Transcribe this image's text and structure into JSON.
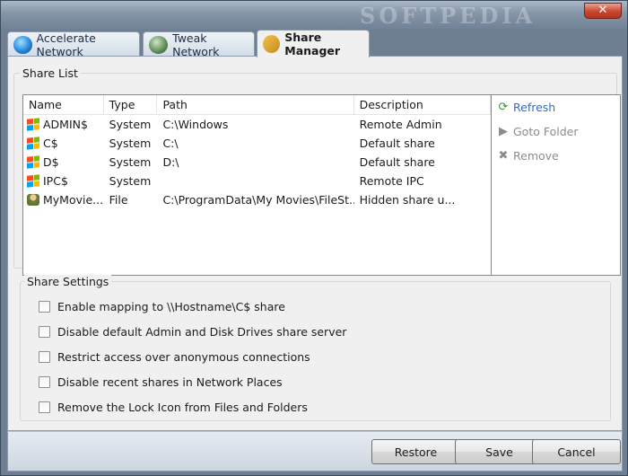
{
  "window": {
    "watermark": "SOFTPEDIA",
    "close_glyph": "✕"
  },
  "tabs": [
    {
      "label": "Accelerate Network",
      "icon": "network-globe-icon"
    },
    {
      "label": "Tweak Network",
      "icon": "tweak-network-icon"
    },
    {
      "label": "Share Manager",
      "icon": "share-manager-icon",
      "active": true
    }
  ],
  "share_list": {
    "title": "Share List",
    "columns": {
      "name": "Name",
      "type": "Type",
      "path": "Path",
      "description": "Description"
    },
    "rows": [
      {
        "name": "ADMIN$",
        "type": "System",
        "path": "C:\\Windows",
        "description": "Remote Admin"
      },
      {
        "name": "C$",
        "type": "System",
        "path": "C:\\",
        "description": "Default share"
      },
      {
        "name": "D$",
        "type": "System",
        "path": "D:\\",
        "description": "Default share"
      },
      {
        "name": "IPC$",
        "type": "System",
        "path": "",
        "description": "Remote IPC"
      },
      {
        "name": "MyMovie...",
        "type": "File",
        "path": "C:\\ProgramData\\My Movies\\FileSt...",
        "description": "Hidden share u..."
      }
    ],
    "actions": {
      "refresh": "Refresh",
      "goto": "Goto Folder",
      "remove": "Remove"
    }
  },
  "share_settings": {
    "title": "Share Settings",
    "options": [
      "Enable mapping to \\\\Hostname\\C$ share",
      "Disable default Admin and Disk Drives share server",
      "Restrict access over anonymous connections",
      "Disable recent shares in Network Places",
      "Remove the Lock Icon from Files and Folders"
    ]
  },
  "footer": {
    "restore": "Restore",
    "save": "Save",
    "cancel": "Cancel"
  }
}
